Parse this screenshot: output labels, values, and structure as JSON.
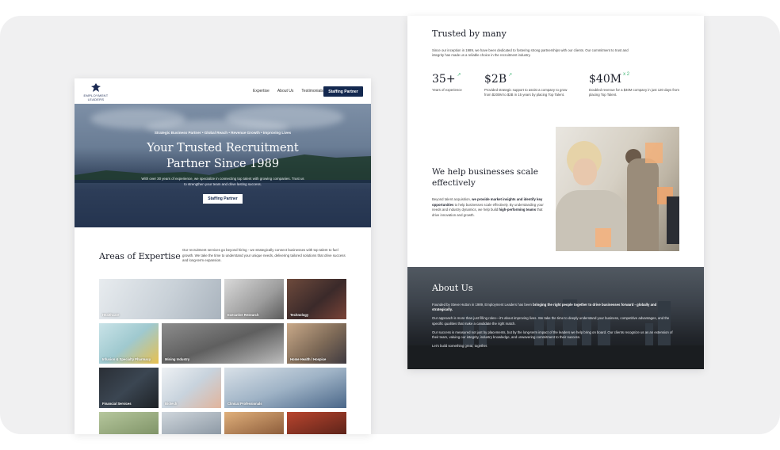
{
  "left_page": {
    "logo": {
      "icon": "eagle-icon",
      "line1": "EMPLOYMENT",
      "line2": "LEADERS"
    },
    "nav": [
      "Expertise",
      "About Us",
      "Testimonials"
    ],
    "cta": "Staffing Partner",
    "hero": {
      "tagline": "Strategic Business Partner  •  Global Reach  •  Revenue Growth  •  Improving Lives",
      "title": "Your Trusted Recruitment Partner Since 1989",
      "subtitle": "With over 30 years of experience, we specialize in connecting top talent with growing companies. Trust us to strengthen your team and drive lasting success.",
      "button": "Staffing Partner"
    },
    "expertise": {
      "title": "Areas of Expertise",
      "text": "Our recruitment services go beyond hiring - we strategically connect businesses with top talent to fuel growth. We take the time to understand your unique needs, delivering tailored solutions that drive success and long-term expansion.",
      "tiles": [
        "Healthcare",
        "Executive Research",
        "Technology",
        "Infusion & Specialty Pharmacy",
        "Mining Industry",
        "Home Health / Hospice",
        "Financial Services",
        "Biotech",
        "Clinical Professionals"
      ]
    }
  },
  "right_page": {
    "trusted": {
      "title": "Trusted by many",
      "text": "Since our inception in 1989, we have been dedicated to fostering strong partnerships with our clients. Our commitment to trust and integrity has made us a reliable choice in the recruitment industry."
    },
    "stats": [
      {
        "value": "35+",
        "suffix": "↗",
        "desc": "Years of experience"
      },
      {
        "value": "$2B",
        "suffix": "↗",
        "desc": "Provided strategic support to assist a company to grow from $200M to $2B in 15 years by placing Top Talent."
      },
      {
        "value": "$40M",
        "suffix": "x 2",
        "desc": "Doubled revenue for a $40M company in just 120 days from placing Top Talent."
      }
    ],
    "scale": {
      "title": "We help businesses scale effectively",
      "text_1": "Beyond talent acquisition, ",
      "bold_1": "we provide market insights and identify key opportunities",
      "text_2": " to help businesses scale effectively. By understanding your needs and industry dynamics, we help build ",
      "bold_2": "high-performing teams",
      "text_3": " that drive innovation and growth."
    },
    "about": {
      "title": "About Us",
      "p1_text": "Founded by Steve Hutton in 1989, Employment Leaders has been ",
      "p1_bold": "bringing the right people together to drive businesses forward - globally and strategically.",
      "p2": "Our approach is more than just filling roles—it's about improving lives. We take the time to deeply understand your business, competitive advantages, and the specific qualities that make a candidate the right match.",
      "p3": "Our success is measured not just by placements, but by the long-term impact of the leaders we help bring on board. Our clients recognize us as an extension of their team, valuing our integrity, industry knowledge, and unwavering commitment to their success.",
      "p4": "Let's build something great, together."
    }
  }
}
